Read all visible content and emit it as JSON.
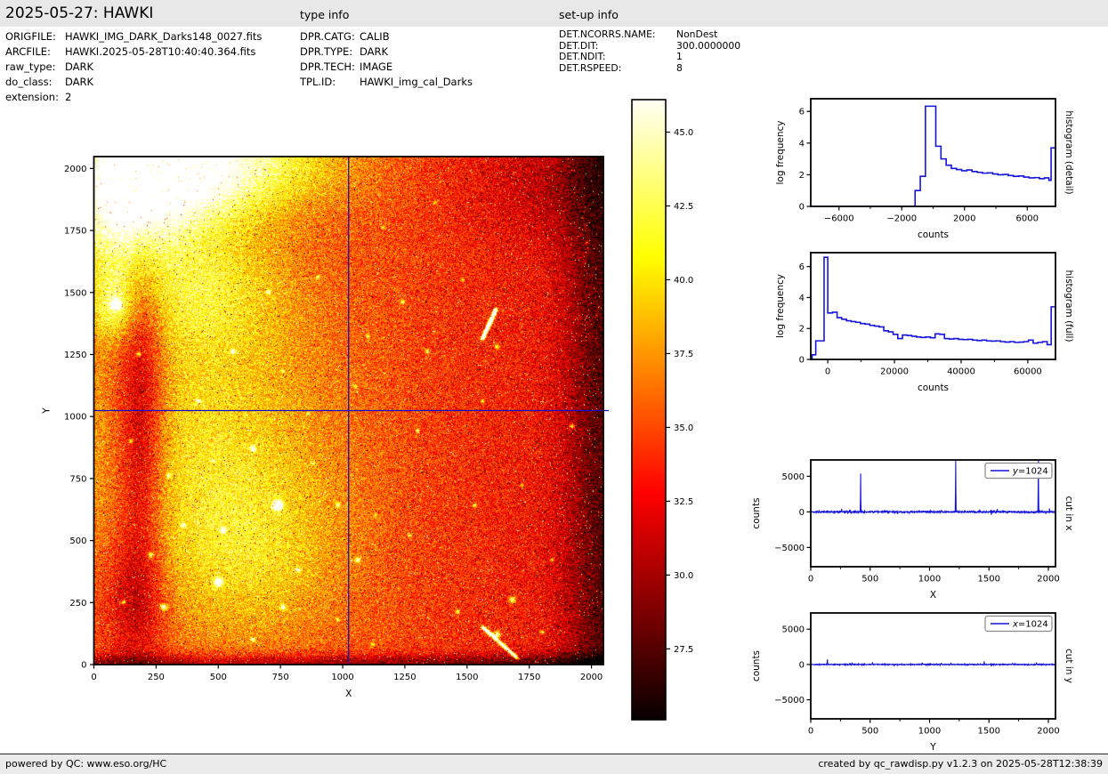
{
  "header": {
    "title": "2025-05-27: HAWKI",
    "type_info_heading": "type info",
    "setup_info_heading": "set-up info"
  },
  "file_info": {
    "rows": [
      {
        "label": "ORIGFILE:",
        "value": "HAWKI_IMG_DARK_Darks148_0027.fits"
      },
      {
        "label": "ARCFILE:",
        "value": "HAWKI.2025-05-28T10:40:40.364.fits"
      },
      {
        "label": "raw_type:",
        "value": "DARK"
      },
      {
        "label": "do_class:",
        "value": "DARK"
      },
      {
        "label": "extension:",
        "value": "2"
      }
    ]
  },
  "type_info": {
    "rows": [
      {
        "label": "DPR.CATG:",
        "value": "CALIB"
      },
      {
        "label": "DPR.TYPE:",
        "value": "DARK"
      },
      {
        "label": "DPR.TECH:",
        "value": "IMAGE"
      },
      {
        "label": "TPL.ID:",
        "value": "HAWKI_img_cal_Darks"
      }
    ]
  },
  "setup_info": {
    "rows": [
      {
        "label": "DET.NCORRS.NAME:",
        "value": "NonDest"
      },
      {
        "label": "DET.DIT:",
        "value": "300.0000000"
      },
      {
        "label": "DET.NDIT:",
        "value": "1"
      },
      {
        "label": "DET.RSPEED:",
        "value": "8"
      }
    ]
  },
  "footer": {
    "left": "powered by QC: www.eso.org/HC",
    "right": "created by qc_rawdisp.py v1.2.3 on 2025-05-28T12:38:39"
  },
  "colors": {
    "line_blue": "#1414dd",
    "crosshair_blue": "#0d0dcc",
    "header_bg": "#e8e8e8",
    "footer_bg": "#ececec",
    "colormap": "hot"
  },
  "chart_data": [
    {
      "name": "dark-frame-image",
      "type": "heatmap",
      "xlabel": "X",
      "ylabel": "Y",
      "xlim": [
        0,
        2048
      ],
      "ylim": [
        0,
        2048
      ],
      "x_ticks": [
        0,
        250,
        500,
        750,
        1000,
        1250,
        1500,
        1750,
        2000
      ],
      "y_ticks": [
        0,
        250,
        500,
        750,
        1000,
        1250,
        1500,
        1750,
        2000
      ],
      "crosshair": {
        "x": 1024,
        "y": 1024
      },
      "colorbar": {
        "ticks": [
          27.5,
          30.0,
          32.5,
          35.0,
          37.5,
          40.0,
          42.5,
          45.0
        ],
        "vmin": 25.1,
        "vmax": 46.1
      }
    },
    {
      "name": "histogram-detail",
      "type": "histogram",
      "xlabel": "counts",
      "ylabel": "log frequency",
      "right_label": "histogram (detail)",
      "xlim": [
        -7800,
        7800
      ],
      "ylim": [
        0,
        6.8
      ],
      "x_ticks": [
        -6000,
        -2000,
        2000,
        6000
      ],
      "x_minor": [
        -4000,
        0,
        4000
      ],
      "y_ticks": [
        0,
        2,
        4,
        6
      ],
      "bin_edges": [
        -1150,
        -820,
        -490,
        170,
        500,
        830,
        1160,
        1490,
        1820,
        2150,
        2480,
        2810,
        3140,
        3470,
        3800,
        4130,
        4460,
        4790,
        5120,
        5450,
        5780,
        6110,
        6440,
        6770,
        7100,
        7380,
        7520,
        7800
      ],
      "log_freq": [
        1.0,
        1.9,
        6.33,
        3.8,
        3.0,
        2.6,
        2.4,
        2.33,
        2.25,
        2.3,
        2.2,
        2.15,
        2.1,
        2.12,
        2.05,
        2.0,
        2.02,
        1.95,
        1.9,
        1.92,
        1.85,
        1.8,
        1.82,
        1.75,
        1.8,
        1.65,
        3.7
      ]
    },
    {
      "name": "histogram-full",
      "type": "histogram",
      "xlabel": "counts",
      "ylabel": "log frequency",
      "right_label": "histogram (full)",
      "xlim": [
        -5100,
        68300
      ],
      "ylim": [
        0,
        6.9
      ],
      "x_ticks": [
        0,
        20000,
        40000,
        60000
      ],
      "x_minor": [
        10000,
        30000,
        50000
      ],
      "y_ticks": [
        0,
        2,
        4,
        6
      ],
      "bin_edges": [
        -4700,
        -3600,
        -1100,
        0,
        1400,
        2800,
        4200,
        5600,
        7000,
        8400,
        9800,
        11200,
        12600,
        14000,
        15400,
        16800,
        18200,
        19600,
        21000,
        22400,
        23800,
        25200,
        26600,
        28000,
        29400,
        30800,
        32200,
        33600,
        35000,
        36400,
        37800,
        39200,
        40600,
        42000,
        43400,
        44800,
        46200,
        47600,
        49000,
        50400,
        51800,
        53200,
        54600,
        56000,
        57400,
        58800,
        60200,
        61600,
        63000,
        64400,
        65800,
        67000,
        68300
      ],
      "log_freq": [
        0.3,
        1.2,
        6.6,
        3.0,
        3.05,
        2.7,
        2.6,
        2.5,
        2.45,
        2.4,
        2.32,
        2.28,
        2.2,
        2.15,
        2.1,
        1.85,
        1.78,
        1.62,
        1.35,
        1.58,
        1.55,
        1.5,
        1.45,
        1.42,
        1.45,
        1.4,
        1.65,
        1.62,
        1.35,
        1.32,
        1.35,
        1.3,
        1.28,
        1.3,
        1.25,
        1.22,
        1.25,
        1.2,
        1.18,
        1.2,
        1.15,
        1.12,
        1.15,
        1.1,
        1.12,
        1.15,
        1.25,
        1.05,
        1.1,
        1.15,
        0.95,
        3.4
      ]
    },
    {
      "name": "cut-in-x",
      "type": "line",
      "xlabel": "X",
      "ylabel": "counts",
      "right_label": "cut in x",
      "legend": "y=1024",
      "xlim": [
        0,
        2060
      ],
      "ylim": [
        -7700,
        7300
      ],
      "x_ticks": [
        0,
        500,
        1000,
        1500,
        2000
      ],
      "x_minor": [
        250,
        750,
        1250,
        1750
      ],
      "y_ticks": [
        -5000,
        0,
        5000
      ],
      "spikes": [
        [
          70,
          150
        ],
        [
          260,
          420
        ],
        [
          420,
          5400
        ],
        [
          640,
          200
        ],
        [
          830,
          -160
        ],
        [
          1005,
          180
        ],
        [
          1100,
          280
        ],
        [
          1220,
          9500
        ],
        [
          1420,
          160
        ],
        [
          1570,
          400
        ],
        [
          1760,
          -140
        ],
        [
          1915,
          9500
        ],
        [
          2010,
          480
        ]
      ],
      "noise_amp": 90
    },
    {
      "name": "cut-in-y",
      "type": "line",
      "xlabel": "Y",
      "ylabel": "counts",
      "right_label": "cut in y",
      "legend": "x=1024",
      "xlim": [
        0,
        2060
      ],
      "ylim": [
        -7700,
        7300
      ],
      "x_ticks": [
        0,
        500,
        1000,
        1500,
        2000
      ],
      "x_minor": [
        250,
        750,
        1250,
        1750
      ],
      "y_ticks": [
        -5000,
        0,
        5000
      ],
      "spikes": [
        [
          140,
          720
        ],
        [
          350,
          160
        ],
        [
          520,
          320
        ],
        [
          700,
          -120
        ],
        [
          940,
          140
        ],
        [
          1100,
          230
        ],
        [
          1180,
          260
        ],
        [
          1320,
          -100
        ],
        [
          1460,
          430
        ],
        [
          1700,
          140
        ],
        [
          1900,
          160
        ]
      ],
      "noise_amp": 55
    }
  ]
}
